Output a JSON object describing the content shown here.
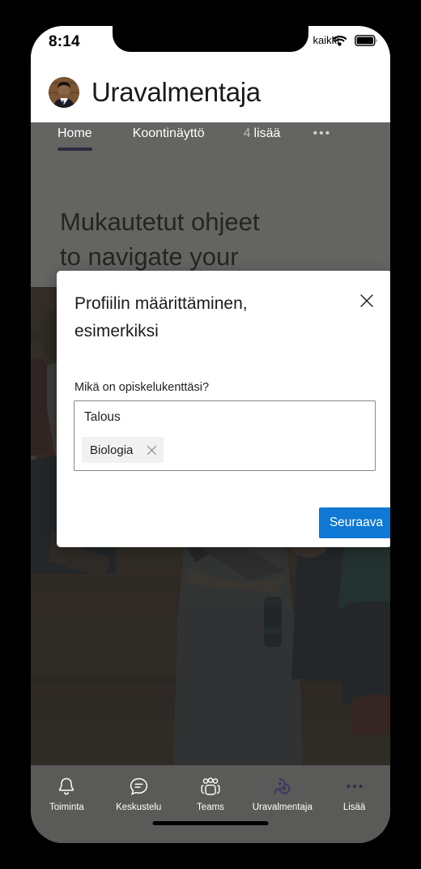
{
  "status_bar": {
    "time": "8:14",
    "carrier": "kaikki",
    "wifi_icon": "wifi-icon",
    "battery_icon": "battery-icon"
  },
  "header": {
    "avatar_icon": "user-avatar",
    "title": "Uravalmentaja"
  },
  "tabs": [
    {
      "label": "Home",
      "active": true
    },
    {
      "label": "Koontinäyttö",
      "active": false
    },
    {
      "count": "4",
      "label": "lisää",
      "active": false
    }
  ],
  "tab_overflow_icon": "ellipsis-icon",
  "page": {
    "heading_line1": "Mukautetut ohjeet",
    "heading_line2": "to navigate your",
    "photo_alt": "students-sitting-on-steps-photo"
  },
  "dialog": {
    "title": "Profiilin määrittäminen, esimerkiksi",
    "close_icon": "close-icon",
    "field_label": "Mikä on opiskelukenttäsi?",
    "field_value": "Talous",
    "field_placeholder": "Talous",
    "chips": [
      {
        "label": "Biologia",
        "remove_icon": "close-icon"
      }
    ],
    "next_button": "Seuraava"
  },
  "bottom_nav": [
    {
      "label": "Toiminta",
      "icon": "bell-icon",
      "active": false
    },
    {
      "label": "Keskustelu",
      "icon": "chat-icon",
      "active": false
    },
    {
      "label": "Teams",
      "icon": "people-icon",
      "active": false
    },
    {
      "label": "Uravalmentaja",
      "icon": "career-coach-icon",
      "active": true
    },
    {
      "label": "Lisää",
      "icon": "ellipsis-icon",
      "active": false
    }
  ],
  "colors": {
    "accent_blue": "#0f78d4",
    "scrim": "#4a4a48",
    "nav_bar": "#5a5a58",
    "active_tab_underline": "#2b2b40",
    "career_coach_purple": "#3b3b63"
  }
}
